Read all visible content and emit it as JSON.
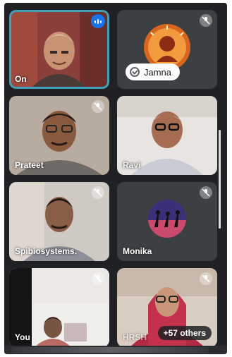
{
  "participants": [
    {
      "name": "On",
      "state": "speaking",
      "icon": "speaking-indicator-icon"
    },
    {
      "name": "Jamna",
      "state": "avatar-logo",
      "icon": "mic-off-icon"
    },
    {
      "name": "Prateet",
      "state": "video",
      "icon": "mic-off-icon"
    },
    {
      "name": "Ravi",
      "state": "video",
      "icon": "mic-off-icon"
    },
    {
      "name": "Spibiosystems.",
      "state": "video",
      "icon": "mic-off-icon"
    },
    {
      "name": "Monika",
      "state": "avatar-image",
      "icon": "mic-off-icon"
    },
    {
      "name": "You",
      "state": "video",
      "icon": "mic-off-icon"
    },
    {
      "name": "+57 others",
      "partial_name": "HRSH",
      "state": "video",
      "icon": "mic-off-icon"
    }
  ],
  "colors": {
    "background": "#1f2124",
    "tile": "#3c4043",
    "speaking_blue": "#1a73e8",
    "active_border": "#3fa0b8"
  }
}
